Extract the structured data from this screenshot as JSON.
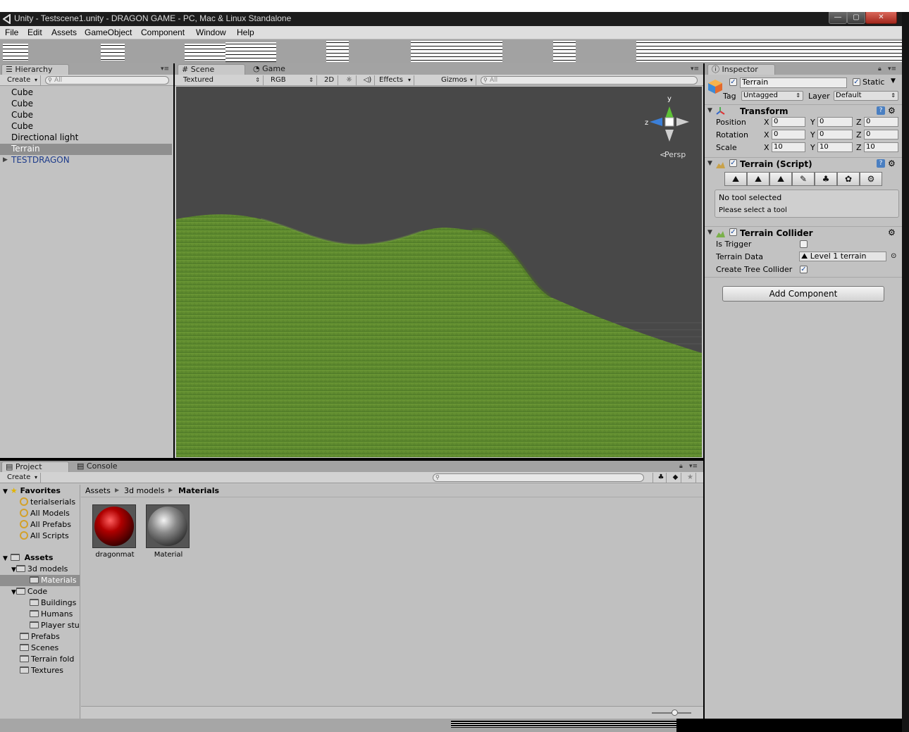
{
  "window": {
    "title": "Unity - Testscene1.unity - DRAGON GAME - PC, Mac & Linux Standalone",
    "buttons": {
      "minimize": "—",
      "maximize": "▢",
      "close": "✕"
    }
  },
  "menu": [
    "File",
    "Edit",
    "Assets",
    "GameObject",
    "Component",
    "Window",
    "Help"
  ],
  "hierarchy": {
    "tab": "Hierarchy",
    "create": "Create",
    "search_placeholder": "All",
    "items": [
      "Cube",
      "Cube",
      "Cube",
      "Cube",
      "Directional light",
      "Terrain",
      "TESTDRAGON"
    ],
    "selected": "Terrain"
  },
  "scene": {
    "tabs": [
      "Scene",
      "Game"
    ],
    "render_mode": "Textured",
    "color_mode": "RGB",
    "mode_2d": "2D",
    "effects": "Effects",
    "gizmos": "Gizmos",
    "search_placeholder": "All",
    "gizmo": {
      "y": "y",
      "z": "z",
      "projection": "Persp"
    }
  },
  "inspector": {
    "tab": "Inspector",
    "object_name": "Terrain",
    "static_label": "Static",
    "static_checked": true,
    "tag_label": "Tag",
    "tag_value": "Untagged",
    "layer_label": "Layer",
    "layer_value": "Default",
    "transform": {
      "title": "Transform",
      "rows": [
        {
          "label": "Position",
          "x": "0",
          "y": "0",
          "z": "0"
        },
        {
          "label": "Rotation",
          "x": "0",
          "y": "0",
          "z": "0"
        },
        {
          "label": "Scale",
          "x": "10",
          "y": "10",
          "z": "10"
        }
      ],
      "axes": [
        "X",
        "Y",
        "Z"
      ]
    },
    "terrain_script": {
      "title": "Terrain (Script)",
      "tools": [
        "raise-lower",
        "paint-height",
        "smooth-height",
        "paint-texture",
        "place-trees",
        "paint-details",
        "settings"
      ],
      "message_line1": "No tool selected",
      "message_line2": "Please select a tool"
    },
    "terrain_collider": {
      "title": "Terrain Collider",
      "is_trigger_label": "Is Trigger",
      "is_trigger": false,
      "terrain_data_label": "Terrain Data",
      "terrain_data_value": "Level 1 terrain",
      "create_tree_label": "Create Tree Collider",
      "create_tree": true
    },
    "add_component": "Add Component"
  },
  "project": {
    "tabs": [
      "Project",
      "Console"
    ],
    "create": "Create",
    "favorites_label": "Favorites",
    "favorites": [
      "terialserials",
      "All Models",
      "All Prefabs",
      "All Scripts"
    ],
    "assets_label": "Assets",
    "tree": [
      {
        "label": "3d models",
        "indent": 1,
        "expanded": true
      },
      {
        "label": "Materials",
        "indent": 2,
        "selected": true
      },
      {
        "label": "Code",
        "indent": 1,
        "expanded": true
      },
      {
        "label": "Buildings",
        "indent": 2
      },
      {
        "label": "Humans",
        "indent": 2
      },
      {
        "label": "Player stu",
        "indent": 2
      },
      {
        "label": "Prefabs",
        "indent": 1
      },
      {
        "label": "Scenes",
        "indent": 1
      },
      {
        "label": "Terrain fold",
        "indent": 1
      },
      {
        "label": "Textures",
        "indent": 1
      }
    ],
    "breadcrumb": [
      "Assets",
      "3d models",
      "Materials"
    ],
    "items": [
      {
        "name": "dragonmat",
        "color": "#a00000"
      },
      {
        "name": "Material",
        "color": "#8a8a8a"
      }
    ]
  },
  "colors": {
    "terrain_green": "#5f8a30",
    "sky_gray": "#484848",
    "panel_bg": "#c2c2c2",
    "selection": "#8f8f8f"
  }
}
